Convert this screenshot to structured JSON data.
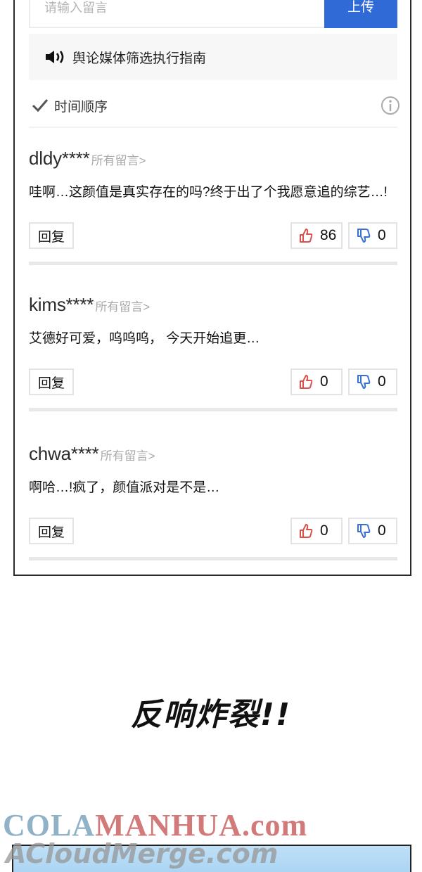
{
  "input": {
    "placeholder": "请输入留言",
    "upload_label": "上传"
  },
  "guide": {
    "label": "舆论媒体筛选执行指南",
    "icon": "speaker-icon"
  },
  "sort": {
    "label": "时间顺序",
    "icon": "check-icon",
    "info_icon": "info-icon"
  },
  "comments": [
    {
      "user": "dldy****",
      "all_label": "所有留言>",
      "text": "哇啊…这颜值是真实存在的吗?终于出了个我愿意追的综艺…!",
      "reply_label": "回复",
      "likes": "86",
      "dislikes": "0"
    },
    {
      "user": "kims****",
      "all_label": "所有留言>",
      "text": "艾德好可爱，呜呜呜， 今天开始追更…",
      "reply_label": "回复",
      "likes": "0",
      "dislikes": "0"
    },
    {
      "user": "chwa****",
      "all_label": "所有留言>",
      "text": "啊哈…!疯了，颜值派对是不是…",
      "reply_label": "回复",
      "likes": "0",
      "dislikes": "0"
    }
  ],
  "reaction_text": "反响炸裂!!",
  "watermark": {
    "line1_a": "COLA",
    "line1_b": "MANHUA",
    "line1_c": ".com",
    "line2": "ACloudMerge.com"
  },
  "colors": {
    "upload_button": "#2f6ad6",
    "like_icon": "#d8514b",
    "dislike_icon": "#3b6fd1"
  }
}
